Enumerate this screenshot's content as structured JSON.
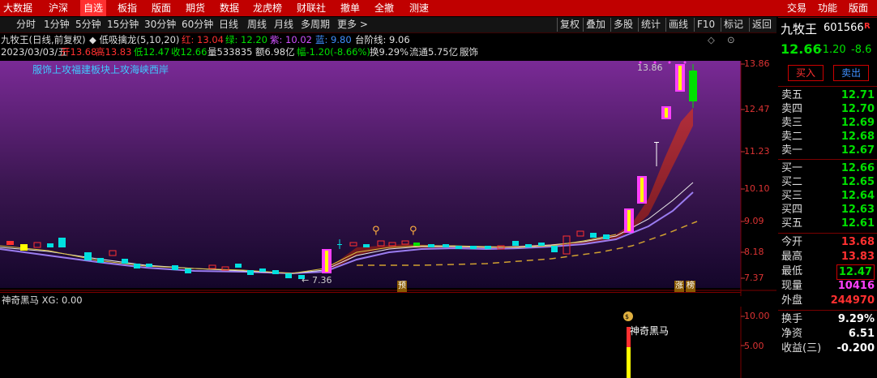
{
  "menubar": {
    "items": [
      "大数据",
      "沪深",
      "自选",
      "板指",
      "版面",
      "期货",
      "数据",
      "龙虎榜",
      "财联社",
      "撤单",
      "全撤",
      "测速"
    ],
    "right_items": [
      "交易",
      "功能",
      "版面"
    ]
  },
  "periodbar": {
    "periods": [
      "分时",
      "1分钟",
      "5分钟",
      "15分钟",
      "30分钟",
      "60分钟",
      "日线",
      "周线",
      "月线",
      "多周期",
      "更多 >"
    ],
    "tools": [
      "复权",
      "叠加",
      "多股",
      "统计",
      "画线",
      "F10",
      "标记",
      "返回"
    ]
  },
  "stock": {
    "name": "九牧王",
    "code": "601566",
    "code_flag": "R",
    "price": "12.66",
    "change": "-1.20",
    "change_pct": "-8.6"
  },
  "chart_header": {
    "title": "九牧王(日线,前复权)",
    "indicator": "◆ 低吸擒龙(5,10,20)",
    "red": "红: 13.04",
    "green": "绿: 12.20",
    "purple": "紫: 10.02",
    "blue": "蓝: 9.80",
    "ladder": "台阶线: 9.06",
    "line2_date": "2023/03/03/五",
    "line2_open": "开13.68",
    "line2_high": "高13.83",
    "line2_low": "低12.47",
    "line2_close": "收12.66",
    "line2_vol": "量533835",
    "line2_amount": "额6.98亿",
    "line2_pct": "幅-1.20(-8.66%)",
    "line2_turnover": "换9.29%",
    "line2_float": "流通5.75亿",
    "line2_sector": "服饰",
    "banner": "服饰上攻福建板块上攻海峡西岸",
    "high_mark": "13.86",
    "low_mark": "7.36",
    "tag_yu": "预",
    "tag_zhang": "涨",
    "tag_bang": "榜"
  },
  "price_axis": [
    "13.86",
    "12.47",
    "11.23",
    "10.10",
    "9.09",
    "8.18",
    "7.37"
  ],
  "sub_chart": {
    "title": "神奇黑马  XG: 0.00",
    "label": "神奇黑马",
    "axis": [
      "10.00",
      "5.00"
    ]
  },
  "quote": {
    "buy_label": "买入",
    "sell_label": "卖出",
    "asks": [
      {
        "label": "卖五",
        "price": "12.71"
      },
      {
        "label": "卖四",
        "price": "12.70"
      },
      {
        "label": "卖三",
        "price": "12.69"
      },
      {
        "label": "卖二",
        "price": "12.68"
      },
      {
        "label": "卖一",
        "price": "12.67"
      }
    ],
    "bids": [
      {
        "label": "买一",
        "price": "12.66"
      },
      {
        "label": "买二",
        "price": "12.65"
      },
      {
        "label": "买三",
        "price": "12.64"
      },
      {
        "label": "买四",
        "price": "12.63"
      },
      {
        "label": "买五",
        "price": "12.61"
      }
    ],
    "stats": [
      {
        "label": "今开",
        "value": "13.68",
        "color": "#ff3030"
      },
      {
        "label": "最高",
        "value": "13.83",
        "color": "#ff3030"
      },
      {
        "label": "最低",
        "value": "12.47",
        "color": "#00e000"
      },
      {
        "label": "现量",
        "value": "10416",
        "color": "#ff40ff"
      },
      {
        "label": "外盘",
        "value": "244970",
        "color": "#ff3030"
      },
      {
        "label": "换手",
        "value": "9.29%",
        "color": "#ffffff"
      },
      {
        "label": "净资",
        "value": "6.51",
        "color": "#ffffff"
      },
      {
        "label": "收益(三)",
        "value": "-0.200",
        "color": "#ffffff"
      }
    ]
  },
  "colors": {
    "up": "#ff3030",
    "down": "#00e0e0",
    "accent": "#c00000",
    "magenta": "#ff40ff"
  }
}
